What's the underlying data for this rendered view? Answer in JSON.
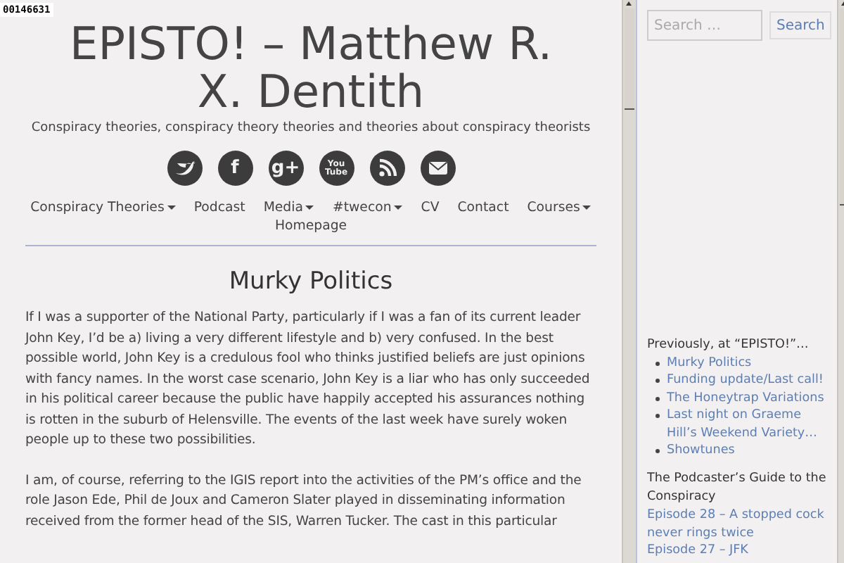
{
  "counter": "00146631",
  "header": {
    "title": "EPISTO! – Matthew R. X. Dentith",
    "tagline": "Conspiracy theories, conspiracy theory theories and theories about conspiracy theorists"
  },
  "social": [
    {
      "kind": "bird"
    },
    {
      "kind": "letter",
      "label": "f"
    },
    {
      "kind": "letter",
      "label": "g+"
    },
    {
      "kind": "letter",
      "label": "You Tube"
    },
    {
      "kind": "rss"
    },
    {
      "kind": "mail"
    }
  ],
  "nav": [
    {
      "label": "Conspiracy Theories",
      "dropdown": true
    },
    {
      "label": "Podcast",
      "dropdown": false
    },
    {
      "label": "Media",
      "dropdown": true
    },
    {
      "label": "#twecon",
      "dropdown": true
    },
    {
      "label": "CV",
      "dropdown": false
    },
    {
      "label": "Contact",
      "dropdown": false
    },
    {
      "label": "Courses",
      "dropdown": true
    },
    {
      "label": "Homepage",
      "dropdown": false
    }
  ],
  "post": {
    "title": "Murky Politics",
    "paragraphs": [
      "If I was a supporter of the National Party, particularly if I was a fan of its current leader John Key, I’d be a) living a very different lifestyle and b) very confused. In the best possible world, John Key is a credulous fool who thinks justified beliefs are just opinions with fancy names. In the worst case scenario, John Key is a liar who has only succeeded in his political career because the public have happily accepted his assurances nothing is rotten in the suburb of Helensville. The events of the last week have surely woken people up to these two possibilities.",
      "I am, of course, referring to the IGIS report into the activities of the PM’s office and the role Jason Ede, Phil de Joux and Cameron Slater played in disseminating information received from the former head of the SIS, Warren Tucker. The cast in this particular"
    ]
  },
  "sidebar": {
    "search": {
      "placeholder": "Search …",
      "button": "Search"
    },
    "recent": {
      "title": "Previously, at “EPISTO!”…",
      "items": [
        "Murky Politics",
        "Funding update/Last call!",
        "The Honeytrap Variations",
        "Last night on Graeme Hill’s Weekend Variety…",
        "Showtunes"
      ]
    },
    "podcast": {
      "title": "The Podcaster’s Guide to the Conspiracy",
      "items": [
        "Episode 28 – A stopped cock never rings twice",
        "Episode 27 – JFK"
      ]
    }
  }
}
